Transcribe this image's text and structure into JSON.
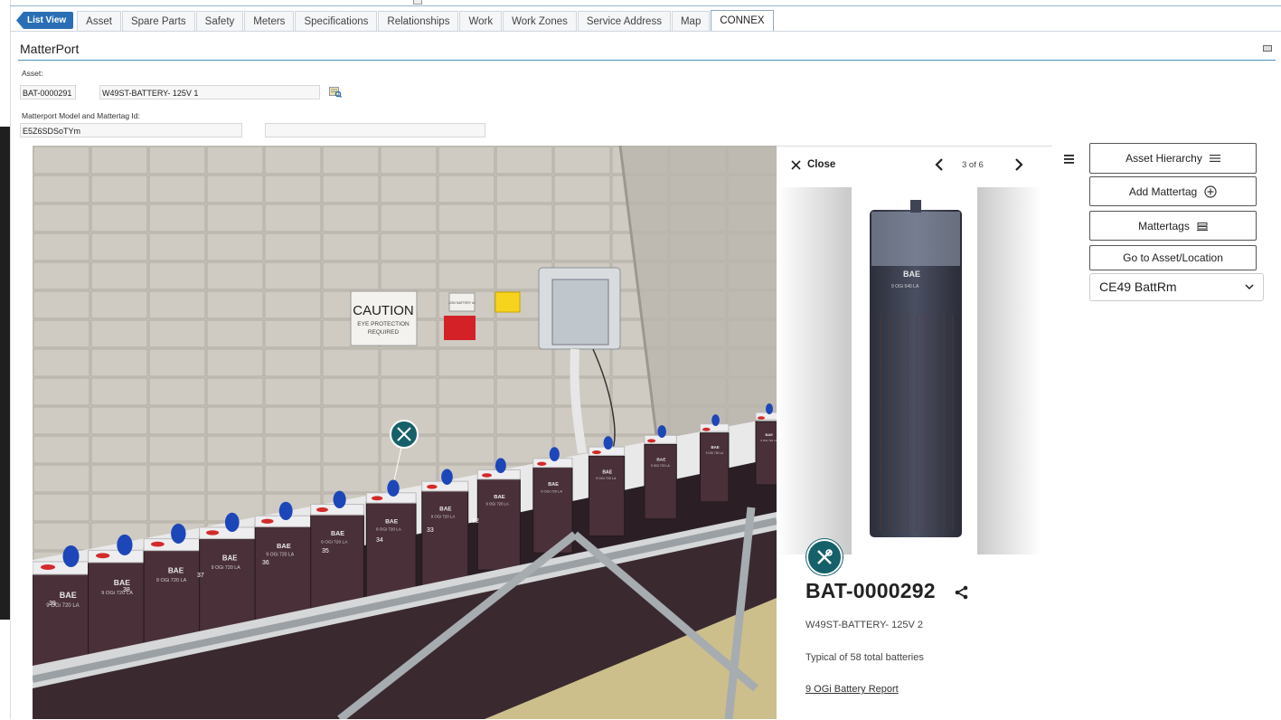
{
  "tabs": {
    "list_view": "List View",
    "items": [
      "Asset",
      "Spare Parts",
      "Safety",
      "Meters",
      "Specifications",
      "Relationships",
      "Work",
      "Work Zones",
      "Service Address",
      "Map",
      "CONNEX"
    ],
    "active": "CONNEX"
  },
  "section": {
    "title": "MatterPort"
  },
  "form": {
    "asset_label": "Asset:",
    "asset_id": "BAT-0000291",
    "asset_desc": "W49ST-BATTERY- 125V 1",
    "model_label": "Matterport Model and Mattertag Id:",
    "model_id": "E5Z6SDSoTYm",
    "mattertag_id": ""
  },
  "viewer": {
    "sign_caution": "CAUTION",
    "sign_line1": "EYE PROTECTION",
    "sign_line2": "REQUIRED",
    "battery_brand": "BAE",
    "battery_model": "9 OGi 720 LA",
    "cell_numbers": [
      "39",
      "38",
      "37",
      "36",
      "35",
      "34",
      "33",
      "32"
    ],
    "small_label": "125V BATTERY #1"
  },
  "panel": {
    "close_label": "Close",
    "page_indicator": "3 of 6",
    "asset_id": "BAT-0000292",
    "description": "W49ST-BATTERY- 125V 2",
    "note": "Typical of 58 total batteries",
    "report_link": "9 OGi Battery Report",
    "photo_brand": "BAE",
    "photo_model": "9 OGi 540 LA"
  },
  "sidebar": {
    "buttons": [
      "Asset Hierarchy",
      "Add Mattertag",
      "Mattertags",
      "Go to Asset/Location"
    ],
    "location_select": "CE49 BattRm"
  },
  "colors": {
    "tab_accent": "#2a6fb5",
    "tag_teal": "#16606a",
    "section_rule": "#4a8fb8"
  }
}
